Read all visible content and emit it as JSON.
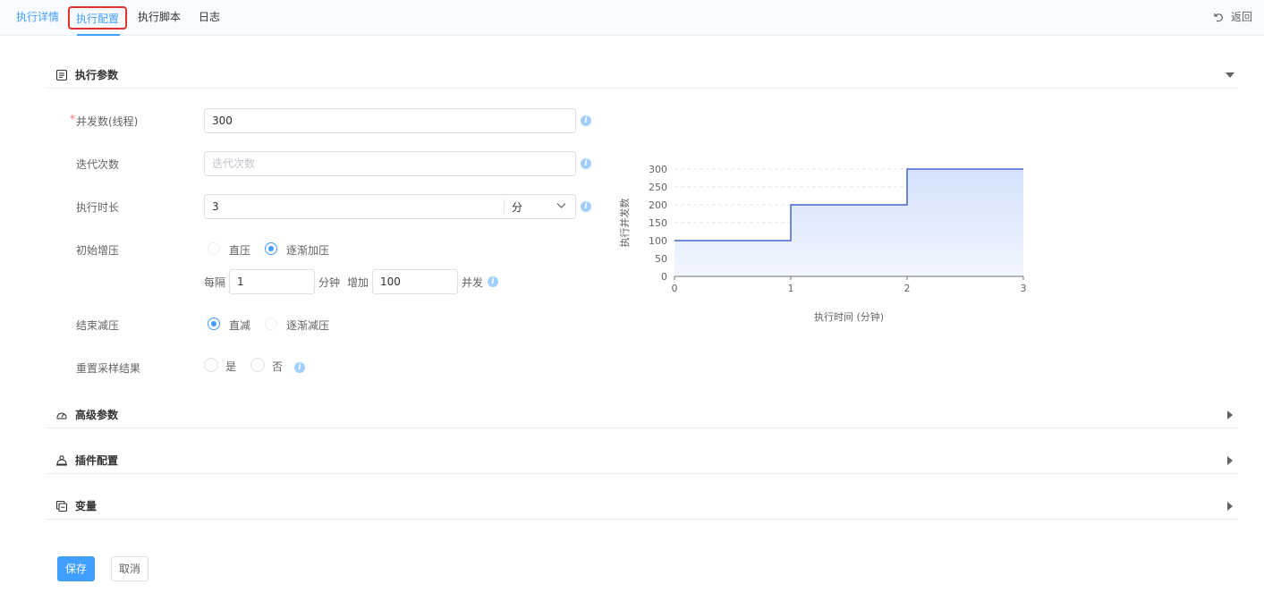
{
  "tabs": [
    {
      "label": "执行详情"
    },
    {
      "label": "执行配置"
    },
    {
      "label": "执行脚本"
    },
    {
      "label": "日志"
    }
  ],
  "back_label": "返回",
  "sections": {
    "exec_params": "执行参数",
    "advanced_params": "高级参数",
    "plugin_config": "插件配置",
    "variables": "变量"
  },
  "form": {
    "concurrency": {
      "label": "并发数(线程)",
      "required_mark": "*",
      "value": "300"
    },
    "iterations": {
      "label": "迭代次数",
      "value": "",
      "placeholder": "迭代次数"
    },
    "duration": {
      "label": "执行时长",
      "value": "3",
      "unit": "分"
    },
    "ramp_up": {
      "label": "初始增压",
      "options": [
        "直压",
        "逐渐加压"
      ],
      "selected": "逐渐加压",
      "every_label": "每隔",
      "every_value": "1",
      "minute_label": "分钟",
      "increase_label": "增加",
      "increase_value": "100",
      "concurrent_label": "并发"
    },
    "ramp_down": {
      "label": "结束减压",
      "options": [
        "直减",
        "逐渐减压"
      ],
      "selected": "直减"
    },
    "reset_sampling": {
      "label": "重置采样结果",
      "options": [
        "是",
        "否"
      ],
      "selected": ""
    }
  },
  "buttons": {
    "save": "保存",
    "cancel": "取消"
  },
  "colors": {
    "accent": "#409eff",
    "highlight_box": "#e4322b",
    "series": "#4a64c8",
    "area_fill": "#dce8fd"
  },
  "icons": {
    "back": "undo-icon",
    "info": "info-icon",
    "collapse": "caret-down-icon",
    "expand": "caret-right-icon"
  },
  "chart_data": {
    "type": "area",
    "step": true,
    "x": [
      0,
      1,
      2,
      3
    ],
    "series": [
      {
        "values": [
          100,
          200,
          300,
          300
        ]
      }
    ],
    "xlabel": "执行时间 (分钟)",
    "ylabel": "执行并发数",
    "xticks": [
      "0",
      "1",
      "2",
      "3"
    ],
    "yticks": [
      "0",
      "50",
      "100",
      "150",
      "200",
      "250",
      "300"
    ],
    "xlim": [
      0,
      3
    ],
    "ylim": [
      0,
      300
    ],
    "grid": true
  }
}
